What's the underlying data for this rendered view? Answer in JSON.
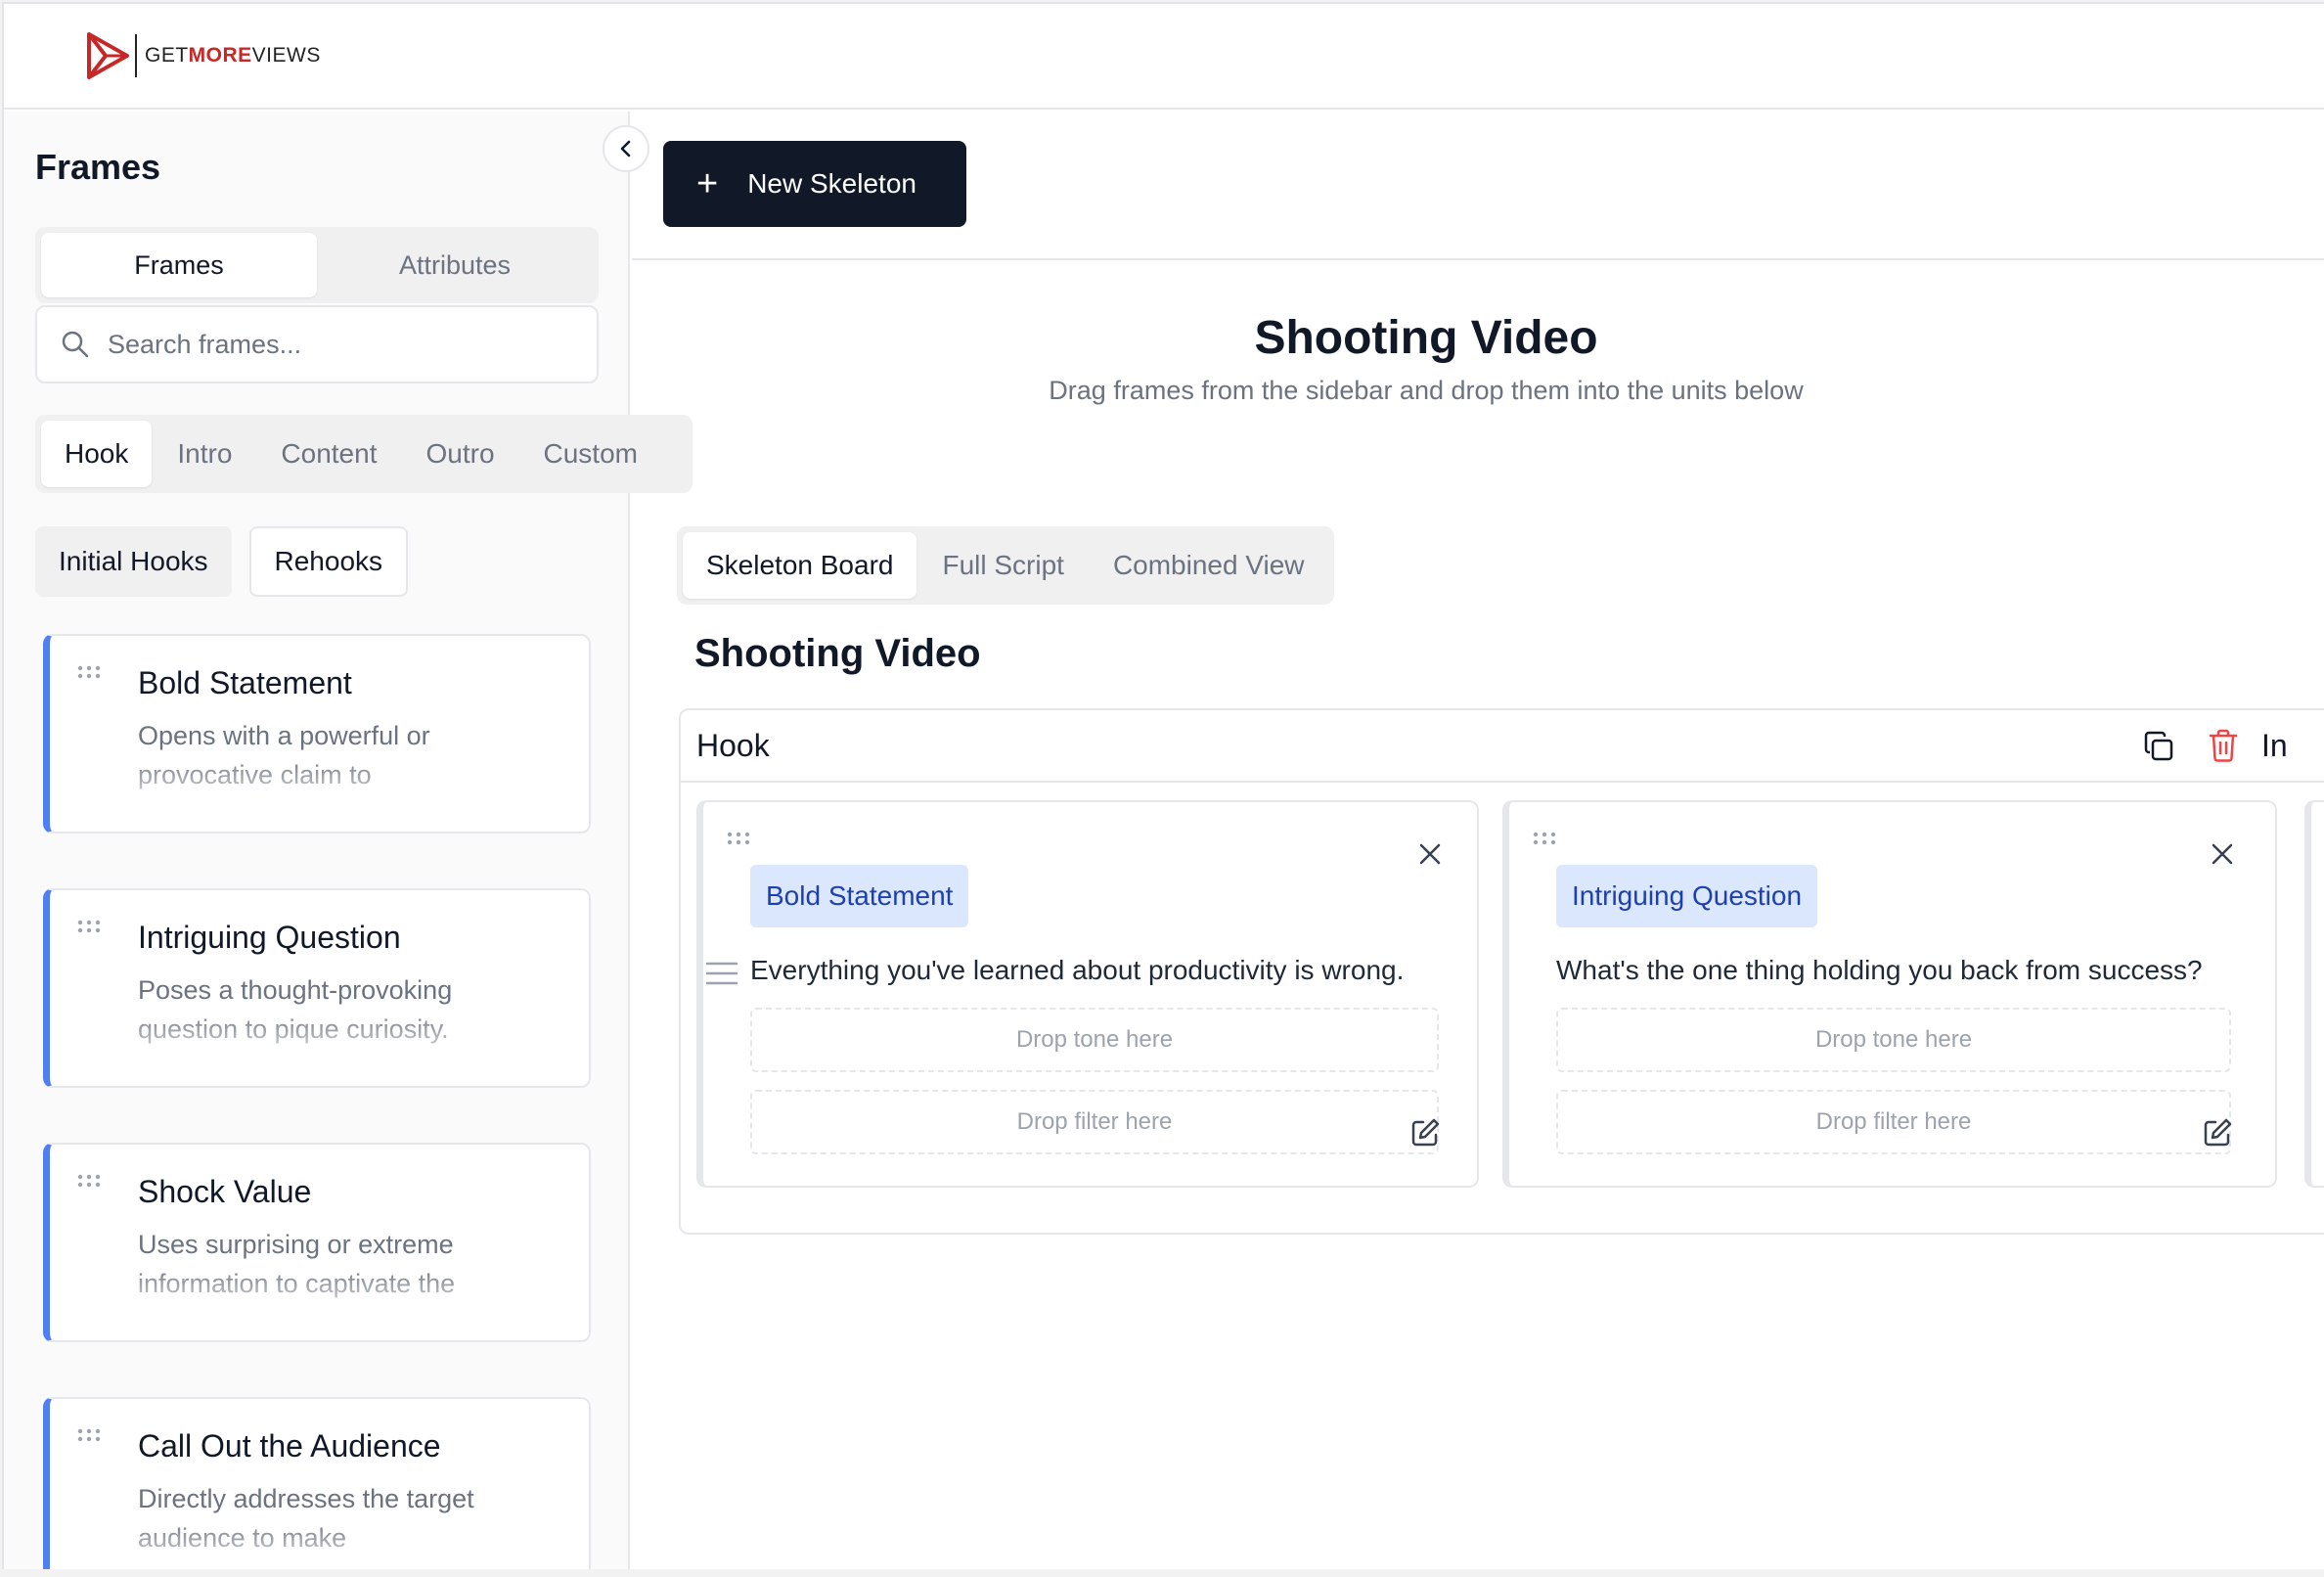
{
  "brand": {
    "logo_prefix": "GET",
    "logo_highlight": "MORE",
    "logo_suffix": "VIEWS",
    "accent": "#c62828"
  },
  "sidebar": {
    "title": "Frames",
    "collapse_icon": "chevron-left-icon",
    "mode_tabs": [
      {
        "label": "Frames",
        "active": true
      },
      {
        "label": "Attributes",
        "active": false
      }
    ],
    "search": {
      "placeholder": "Search frames...",
      "value": ""
    },
    "category_tabs": [
      {
        "label": "Hook",
        "active": true
      },
      {
        "label": "Intro",
        "active": false
      },
      {
        "label": "Content",
        "active": false
      },
      {
        "label": "Outro",
        "active": false
      },
      {
        "label": "Custom",
        "active": false
      }
    ],
    "sub_tabs": [
      {
        "label": "Initial Hooks",
        "active": true
      },
      {
        "label": "Rehooks",
        "active": false
      }
    ],
    "frames": [
      {
        "title": "Bold Statement",
        "description": "Opens with a powerful or provocative claim to"
      },
      {
        "title": "Intriguing Question",
        "description": "Poses a thought-provoking question to pique curiosity."
      },
      {
        "title": "Shock Value",
        "description": "Uses surprising or extreme information to captivate the"
      },
      {
        "title": "Call Out the Audience",
        "description": "Directly addresses the target audience to make"
      }
    ]
  },
  "toolbar": {
    "new_button_label": "New Skeleton",
    "primary_color": "#111827"
  },
  "main": {
    "title": "Shooting Video",
    "subtitle": "Drag frames from the sidebar and drop them into the units below",
    "view_tabs": [
      {
        "label": "Skeleton Board",
        "active": true
      },
      {
        "label": "Full Script",
        "active": false
      },
      {
        "label": "Combined View",
        "active": false
      }
    ],
    "board_title": "Shooting Video",
    "unit": {
      "name": "Hook",
      "next_unit_peek": "In",
      "slots": [
        {
          "tag": "Bold Statement",
          "line": "Everything you've learned about productivity is wrong.",
          "tone_placeholder": "Drop tone here",
          "filter_placeholder": "Drop filter here"
        },
        {
          "tag": "Intriguing Question",
          "line": "What's the one thing holding you back from success?",
          "tone_placeholder": "Drop tone here",
          "filter_placeholder": "Drop filter here"
        }
      ]
    }
  },
  "colors": {
    "tag_bg": "#dbe7fd",
    "tag_text": "#1e40af",
    "frame_accent": "#4f7ff0",
    "delete": "#ef4444"
  }
}
